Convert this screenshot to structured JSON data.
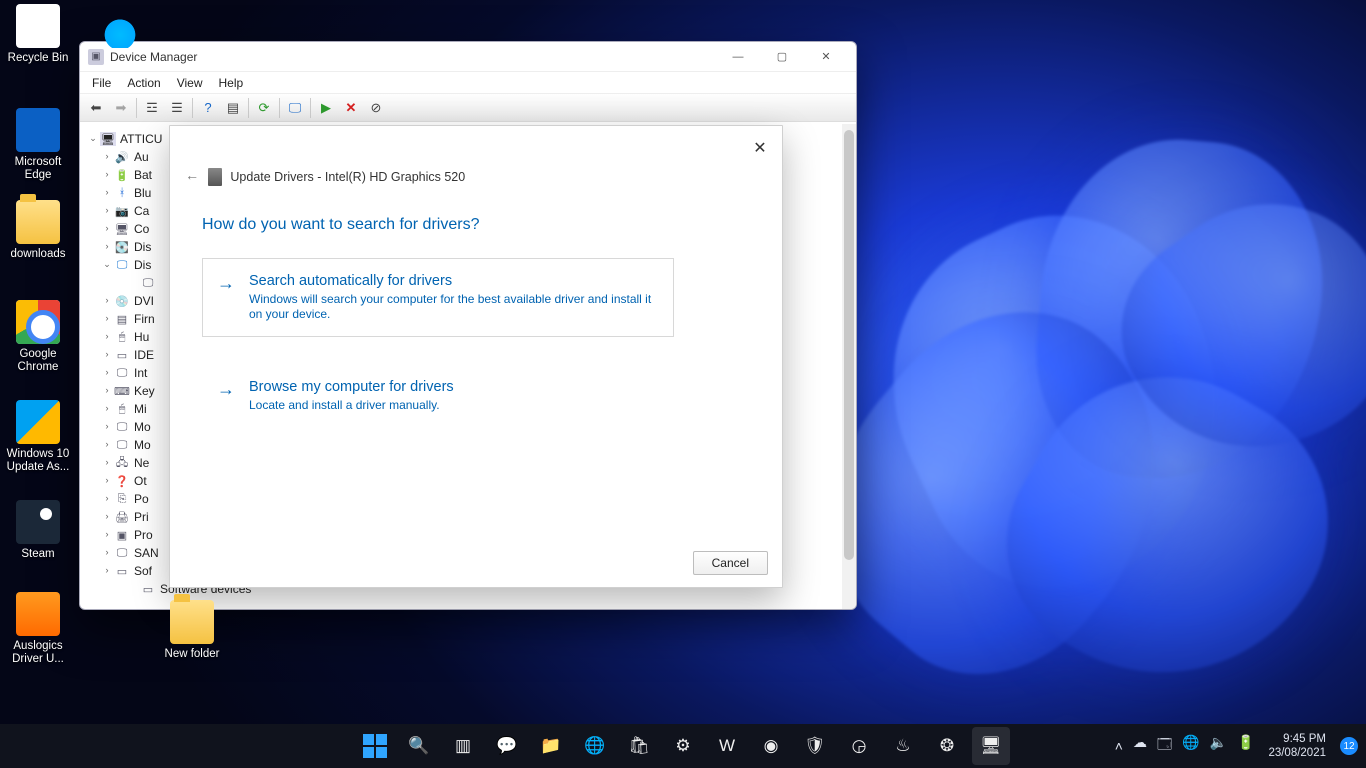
{
  "desktop_icons": [
    {
      "name": "recycle-bin",
      "label": "Recycle Bin",
      "glyph": "g-recycle"
    },
    {
      "name": "flame-app",
      "label": "",
      "glyph": "g-flame"
    },
    {
      "name": "microsoft-edge",
      "label": "Microsoft Edge",
      "glyph": "g-edge"
    },
    {
      "name": "downloads-folder",
      "label": "downloads",
      "glyph": "g-folder"
    },
    {
      "name": "google-chrome",
      "label": "Google Chrome",
      "glyph": "g-chrome"
    },
    {
      "name": "windows-update-assistant",
      "label": "Windows 10 Update As...",
      "glyph": "g-winup"
    },
    {
      "name": "steam",
      "label": "Steam",
      "glyph": "g-steam"
    },
    {
      "name": "auslogics-driver-updater",
      "label": "Auslogics Driver U...",
      "glyph": "g-ausl"
    }
  ],
  "extra_desktop_icons": [
    {
      "name": "new-folder",
      "label": "New folder",
      "glyph": "g-folder"
    }
  ],
  "devmgr": {
    "title": "Device Manager",
    "menus": [
      "File",
      "Action",
      "View",
      "Help"
    ],
    "root": "ATTICU",
    "nodes": [
      {
        "label": "Au",
        "icon": "🔊"
      },
      {
        "label": "Bat",
        "icon": "🔋"
      },
      {
        "label": "Blu",
        "icon": "ᚼ",
        "color": "#1865d6"
      },
      {
        "label": "Ca",
        "icon": "📷"
      },
      {
        "label": "Co",
        "icon": "🖥"
      },
      {
        "label": "Dis",
        "icon": "💽"
      },
      {
        "label": "Dis",
        "icon": "🖵",
        "expanded": true,
        "color": "#1976d2"
      },
      {
        "label": "",
        "icon": "🖵",
        "child": true
      },
      {
        "label": "DVI",
        "icon": "💿"
      },
      {
        "label": "Firn",
        "icon": "▤"
      },
      {
        "label": "Hu",
        "icon": "🖱"
      },
      {
        "label": "IDE",
        "icon": "▭"
      },
      {
        "label": "Int",
        "icon": "🖵"
      },
      {
        "label": "Key",
        "icon": "⌨"
      },
      {
        "label": "Mi",
        "icon": "🖱"
      },
      {
        "label": "Mo",
        "icon": "🖵"
      },
      {
        "label": "Mo",
        "icon": "🖵"
      },
      {
        "label": "Ne",
        "icon": "🖧"
      },
      {
        "label": "Ot",
        "icon": "❓"
      },
      {
        "label": "Po",
        "icon": "⎘"
      },
      {
        "label": "Pri",
        "icon": "🖨"
      },
      {
        "label": "Pro",
        "icon": "▣"
      },
      {
        "label": "SAN",
        "icon": "🖵"
      },
      {
        "label": "Sof",
        "icon": "▭"
      },
      {
        "label": "Software devices",
        "icon": "▭",
        "child": true
      }
    ]
  },
  "update_dialog": {
    "breadcrumb": "Update Drivers - Intel(R) HD Graphics 520",
    "heading": "How do you want to search for drivers?",
    "options": [
      {
        "title": "Search automatically for drivers",
        "desc": "Windows will search your computer for the best available driver and install it on your device."
      },
      {
        "title": "Browse my computer for drivers",
        "desc": "Locate and install a driver manually."
      }
    ],
    "cancel": "Cancel"
  },
  "taskbar": {
    "items": [
      {
        "name": "start",
        "kind": "start"
      },
      {
        "name": "search",
        "glyph": "🔍"
      },
      {
        "name": "task-view",
        "glyph": "▥"
      },
      {
        "name": "chat",
        "glyph": "💬"
      },
      {
        "name": "file-explorer",
        "glyph": "📁"
      },
      {
        "name": "microsoft-edge",
        "glyph": "🌐"
      },
      {
        "name": "microsoft-store",
        "glyph": "🛍"
      },
      {
        "name": "settings",
        "glyph": "⚙"
      },
      {
        "name": "word",
        "glyph": "W"
      },
      {
        "name": "google-chrome",
        "glyph": "◉"
      },
      {
        "name": "security",
        "glyph": "🛡"
      },
      {
        "name": "auslogics",
        "glyph": "◶"
      },
      {
        "name": "flame-app",
        "glyph": "♨"
      },
      {
        "name": "steam",
        "glyph": "❂"
      },
      {
        "name": "device-manager",
        "glyph": "🖥",
        "active": true
      }
    ],
    "tray": {
      "chevron": "˄",
      "icons": [
        "☁",
        "🗔",
        "🌐",
        "🔈",
        "🔋"
      ],
      "time": "9:45 PM",
      "date": "23/08/2021",
      "notif_count": "12"
    }
  }
}
